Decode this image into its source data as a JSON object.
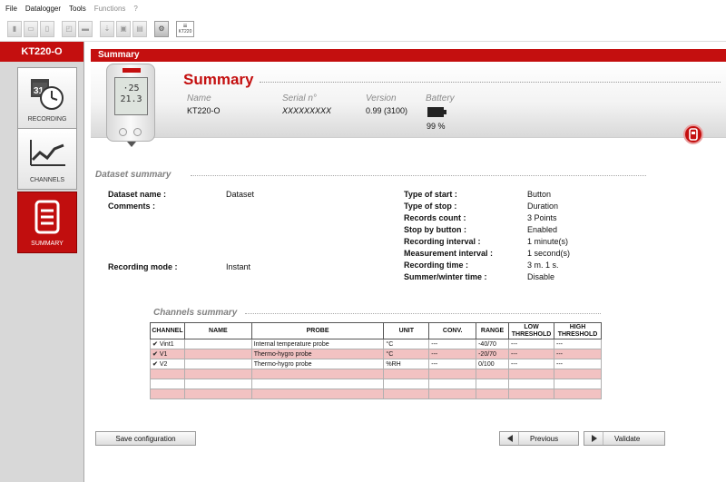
{
  "menu": [
    "File",
    "Datalogger",
    "Tools",
    "Functions",
    "?"
  ],
  "toolbar": {
    "kt_label": "KT220"
  },
  "sidebar": {
    "device_name": "KT220-O",
    "items": [
      {
        "label": "RECORDING",
        "icon": "calendar-clock-icon"
      },
      {
        "label": "CHANNELS",
        "icon": "chart-line-icon"
      },
      {
        "label": "SUMMARY",
        "icon": "document-icon"
      }
    ],
    "calendar_day": "31"
  },
  "header": {
    "bar_title": "Summary",
    "title": "Summary",
    "name_caption": "Name",
    "name_value": "KT220-O",
    "serial_caption": "Serial n°",
    "serial_value": "XXXXXXXXX",
    "version_caption": "Version",
    "version_value": "0.99 (3100)",
    "battery_caption": "Battery",
    "battery_value": "99 %"
  },
  "dataset": {
    "title": "Dataset summary",
    "name_label": "Dataset name :",
    "name_value": "Dataset",
    "comments_label": "Comments :",
    "mode_label": "Recording mode :",
    "mode_value": "Instant",
    "right": [
      {
        "label": "Type of start :",
        "value": "Button"
      },
      {
        "label": "Type of stop :",
        "value": "Duration"
      },
      {
        "label": "Records count :",
        "value": "3 Points"
      },
      {
        "label": "Stop by button :",
        "value": "Enabled"
      },
      {
        "label": "Recording interval :",
        "value": "1 minute(s)"
      },
      {
        "label": "Measurement interval :",
        "value": "1 second(s)"
      },
      {
        "label": "Recording time :",
        "value": "3 m. 1 s."
      },
      {
        "label": "Summer/winter time :",
        "value": "Disable"
      }
    ]
  },
  "channels": {
    "title": "Channels summary",
    "headers": [
      "CHANNEL",
      "NAME",
      "PROBE",
      "UNIT",
      "CONV.",
      "RANGE",
      "LOW THRESHOLD",
      "HIGH THRESHOLD"
    ],
    "rows": [
      {
        "channel": "Vint1",
        "name": "",
        "probe": "Internal temperature probe",
        "unit": "°C",
        "conv": "---",
        "range": "-40/70",
        "low": "---",
        "high": "---"
      },
      {
        "channel": "V1",
        "name": "",
        "probe": "Thermo-hygro probe",
        "unit": "°C",
        "conv": "---",
        "range": "-20/70",
        "low": "---",
        "high": "---"
      },
      {
        "channel": "V2",
        "name": "",
        "probe": "Thermo-hygro probe",
        "unit": "%RH",
        "conv": "---",
        "range": "0/100",
        "low": "---",
        "high": "---"
      }
    ]
  },
  "buttons": {
    "save": "Save configuration",
    "previous": "Previous",
    "validate": "Validate"
  }
}
